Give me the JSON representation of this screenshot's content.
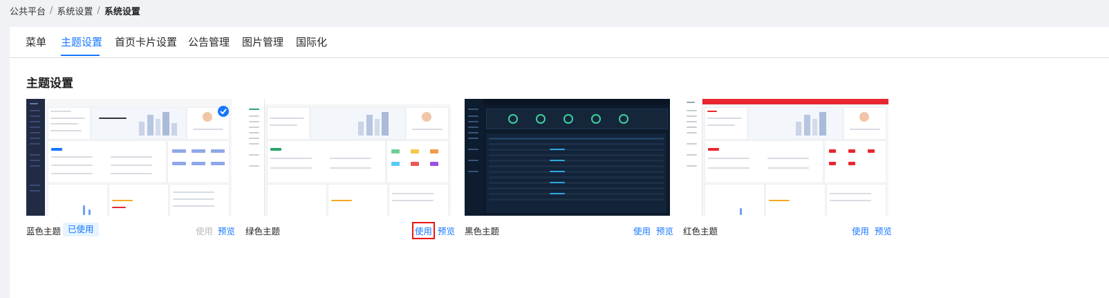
{
  "breadcrumb": [
    "公共平台",
    "系统设置",
    "系统设置"
  ],
  "tabs": [
    {
      "label": "菜单",
      "active": false
    },
    {
      "label": "主题设置",
      "active": true
    },
    {
      "label": "首页卡片设置",
      "active": false
    },
    {
      "label": "公告管理",
      "active": false
    },
    {
      "label": "图片管理",
      "active": false
    },
    {
      "label": "国际化",
      "active": false
    }
  ],
  "section_title": "主题设置",
  "themes": [
    {
      "name": "蓝色主题",
      "status": "已使用",
      "use": "使用",
      "preview": "预览",
      "accent": "#1e2a4a",
      "selected": true
    },
    {
      "name": "绿色主题",
      "use": "使用",
      "preview": "预览",
      "accent": "#2aa56b",
      "highlighted": true
    },
    {
      "name": "黑色主题",
      "use": "使用",
      "preview": "预览",
      "accent": "#0e1a2b"
    },
    {
      "name": "红色主题",
      "use": "使用",
      "preview": "预览",
      "accent": "#e8262f"
    }
  ],
  "colors": {
    "primary": "#1677ff",
    "highlight_box": "#e11111"
  }
}
